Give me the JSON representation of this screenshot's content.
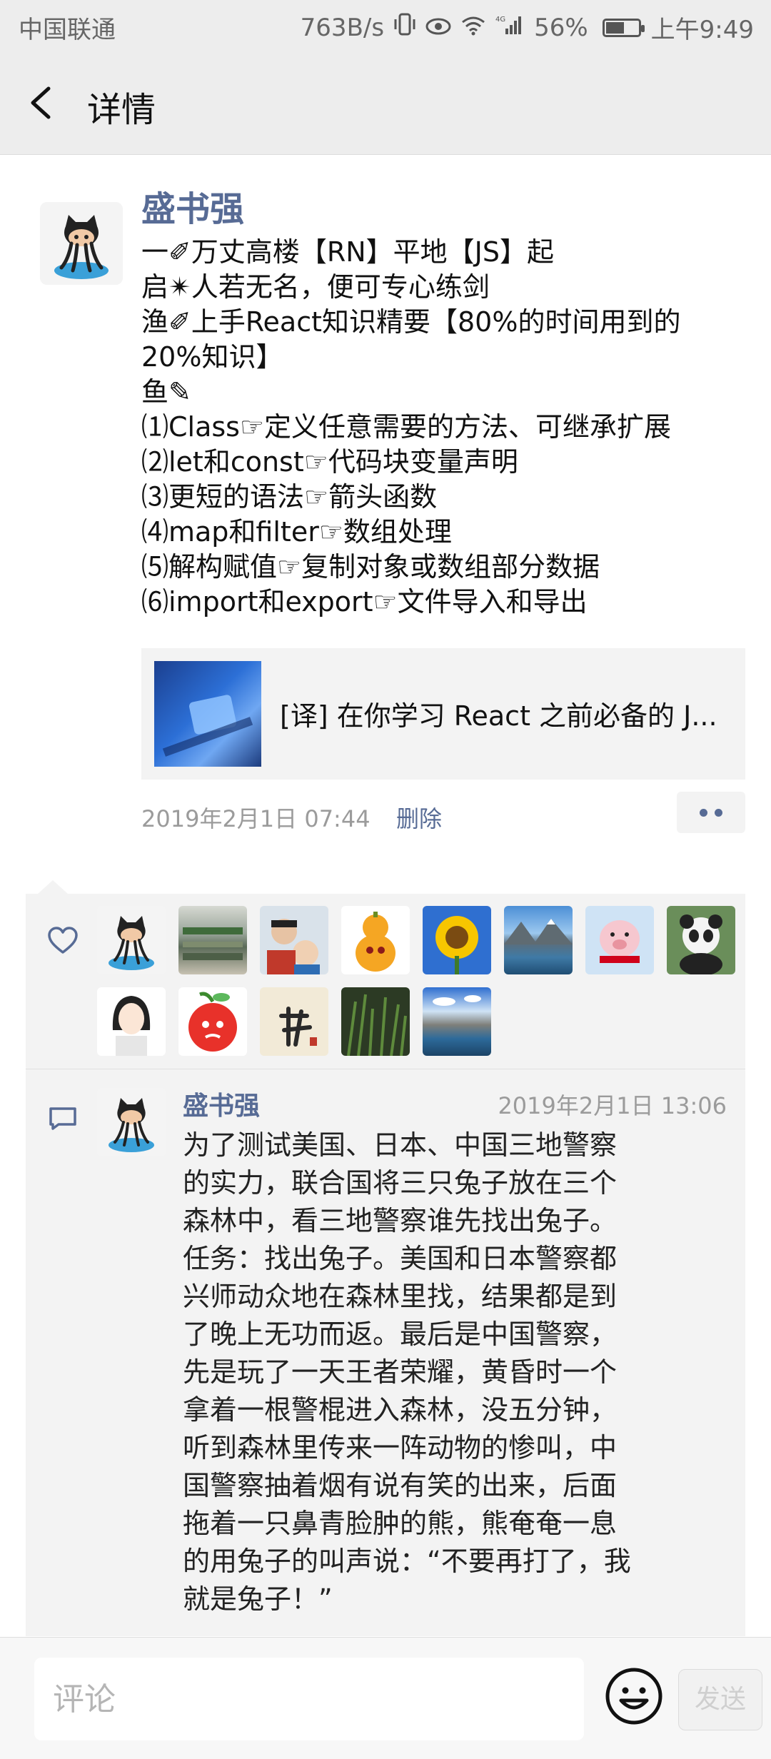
{
  "status_bar": {
    "carrier": "中国联通",
    "net_speed": "763B/s",
    "battery_percent": "56%",
    "battery_level": 0.56,
    "time": "上午9:49",
    "icons": [
      "vibrate-icon",
      "eye-icon",
      "wifi-icon",
      "signal-4g-icon",
      "battery-icon"
    ]
  },
  "nav": {
    "title": "详情",
    "back_icon": "chevron-left-icon"
  },
  "post": {
    "author": "盛书强",
    "lines": [
      "一✐万丈高楼【RN】平地【JS】起",
      "启✴人若无名，便可专心练剑",
      "渔✐上手React知识精要【80%的时间用到的",
      "20%知识】",
      "鱼✎",
      "⑴Class☞定义任意需要的方法、可继承扩展",
      "⑵let和const☞代码块变量声明",
      "⑶更短的语法☞箭头函数",
      "⑷map和filter☞数组处理",
      "⑸解构赋值☞复制对象或数组部分数据",
      "⑹import和export☞文件导入和导出"
    ],
    "link": {
      "title": "[译] 在你学习 React 之前必备的 J..."
    },
    "timestamp": "2019年2月1日 07:44",
    "delete_label": "删除",
    "more_icon": "more-dots-icon"
  },
  "likes": {
    "icon": "heart-outline-icon",
    "avatars": [
      "octocat-avatar",
      "supermarket-avatar",
      "father-child-avatar",
      "orange-gourd-avatar",
      "sunflower-avatar",
      "mountain-lake-avatar",
      "pig-avatar",
      "panda-avatar",
      "cartoon-girl-avatar",
      "red-fruit-character-avatar",
      "calligraphy-avatar",
      "grass-avatar",
      "lake-landscape-avatar"
    ]
  },
  "comment": {
    "icon": "comment-bubble-icon",
    "author": "盛书强",
    "time": "2019年2月1日 13:06",
    "lines": [
      "为了测试美国、日本、中国三地警察",
      "的实力，联合国将三只兔子放在三个",
      "森林中，看三地警察谁先找出兔子。",
      "任务：找出兔子。美国和日本警察都",
      "兴师动众地在森林里找，结果都是到",
      "了晚上无功而返。最后是中国警察，",
      "先是玩了一天王者荣耀，黄昏时一个",
      "拿着一根警棍进入森林，没五分钟，",
      "听到森林里传来一阵动物的惨叫，中",
      "国警察抽着烟有说有笑的出来，后面",
      "拖着一只鼻青脸肿的熊，熊奄奄一息",
      "的用兔子的叫声说：“不要再打了，我",
      "就是兔子！”"
    ]
  },
  "input_bar": {
    "placeholder": "评论",
    "value": "",
    "emoji_icon": "smiley-icon",
    "send_label": "发送"
  }
}
